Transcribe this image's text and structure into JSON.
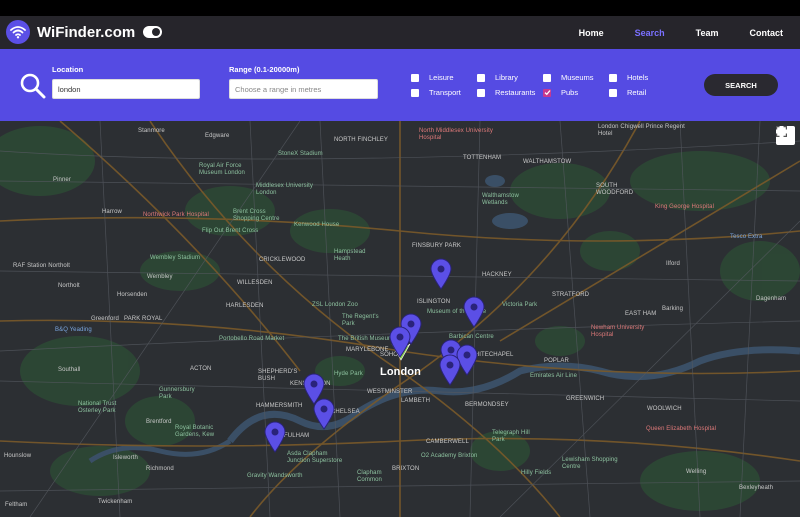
{
  "app": {
    "name": "WiFinder.com",
    "icon": "wifi-icon",
    "theme_toggle": "dark-mode-toggle"
  },
  "nav": {
    "items": [
      {
        "label": "Home",
        "active": false
      },
      {
        "label": "Search",
        "active": true
      },
      {
        "label": "Team",
        "active": false
      },
      {
        "label": "Contact",
        "active": false
      }
    ]
  },
  "search": {
    "icon": "search-icon",
    "location_label": "Location",
    "location_value": "london",
    "range_label": "Range (0.1-20000m)",
    "range_placeholder": "Choose a range in metres",
    "button_label": "SEARCH",
    "categories": [
      {
        "label": "Leisure",
        "checked": false
      },
      {
        "label": "Transport",
        "checked": false
      },
      {
        "label": "Library",
        "checked": false
      },
      {
        "label": "Restaurants",
        "checked": false
      },
      {
        "label": "Museums",
        "checked": false
      },
      {
        "label": "Pubs",
        "checked": true
      },
      {
        "label": "Hotels",
        "checked": false
      },
      {
        "label": "Retail",
        "checked": false
      }
    ]
  },
  "map": {
    "center_label": "London",
    "fullscreen_icon": "fullscreen-icon",
    "marker_color": "#5b4fe6",
    "labels": [
      "Stanmore",
      "Edgware",
      "NORTH FINCHLEY",
      "North Middlesex University Hospital",
      "London Chigwell Prince Regent Hotel",
      "Pinner",
      "Royal Air Force Museum London",
      "StoneX Stadium",
      "Middlesex University London",
      "TOTTENHAM",
      "WALTHAMSTOW",
      "SOUTH WOODFORD",
      "Harrow",
      "Northwick Park Hospital",
      "Brent Cross Shopping Centre",
      "Walthamstow Wetlands",
      "King George Hospital",
      "Flip Out Brent Cross",
      "Kenwood House",
      "Tesco Extra",
      "RAF Station Northolt",
      "Wembley Stadium",
      "CRICKLEWOOD",
      "Hampstead Heath",
      "FINSBURY PARK",
      "Ilford",
      "Wembley",
      "WILLESDEN",
      "HACKNEY",
      "STRATFORD",
      "Northolt",
      "Horsenden",
      "HARLESDEN",
      "ISLINGTON",
      "Victoria Park",
      "Dagenham",
      "ZSL London Zoo",
      "Museum of the Home",
      "B&Q Yeading",
      "Greenford",
      "PARK ROYAL",
      "The Regent's Park",
      "Barking",
      "EAST HAM",
      "Portobello Road Market",
      "The British Museum",
      "Barbican Centre",
      "Newham University Hospital",
      "Southall",
      "ACTON",
      "MARYLEBONE",
      "SOHO",
      "WHITECHAPEL",
      "Hyde Park",
      "POPLAR",
      "SHEPHERD'S BUSH",
      "KENSINGTON",
      "WESTMINSTER",
      "Emirates Air Line",
      "Gunnersbury Park",
      "HAMMERSMITH",
      "CHELSEA",
      "LAMBETH",
      "BERMONDSEY",
      "GREENWICH",
      "WOOLWICH",
      "National Trust Osterley Park",
      "Brentford",
      "Royal Botanic Gardens, Kew",
      "FULHAM",
      "Telegraph Hill Park",
      "CAMBERWELL",
      "Queen Elizabeth Hospital",
      "Hounslow",
      "Isleworth",
      "Asda Clapham Junction Superstore",
      "Lewisham Shopping Centre",
      "Richmond",
      "O2 Academy Brixton",
      "BRIXTON",
      "Clapham Common",
      "Hilly Fields",
      "Gravity Wandsworth",
      "Twickenham",
      "Feltham",
      "Bexleyheath",
      "Welling"
    ]
  },
  "colors": {
    "navbar": "#26252b",
    "searchbar": "#554be3",
    "accent": "#7a70ff",
    "checked": "#c7388f",
    "map_bg": "#2c2f33"
  }
}
